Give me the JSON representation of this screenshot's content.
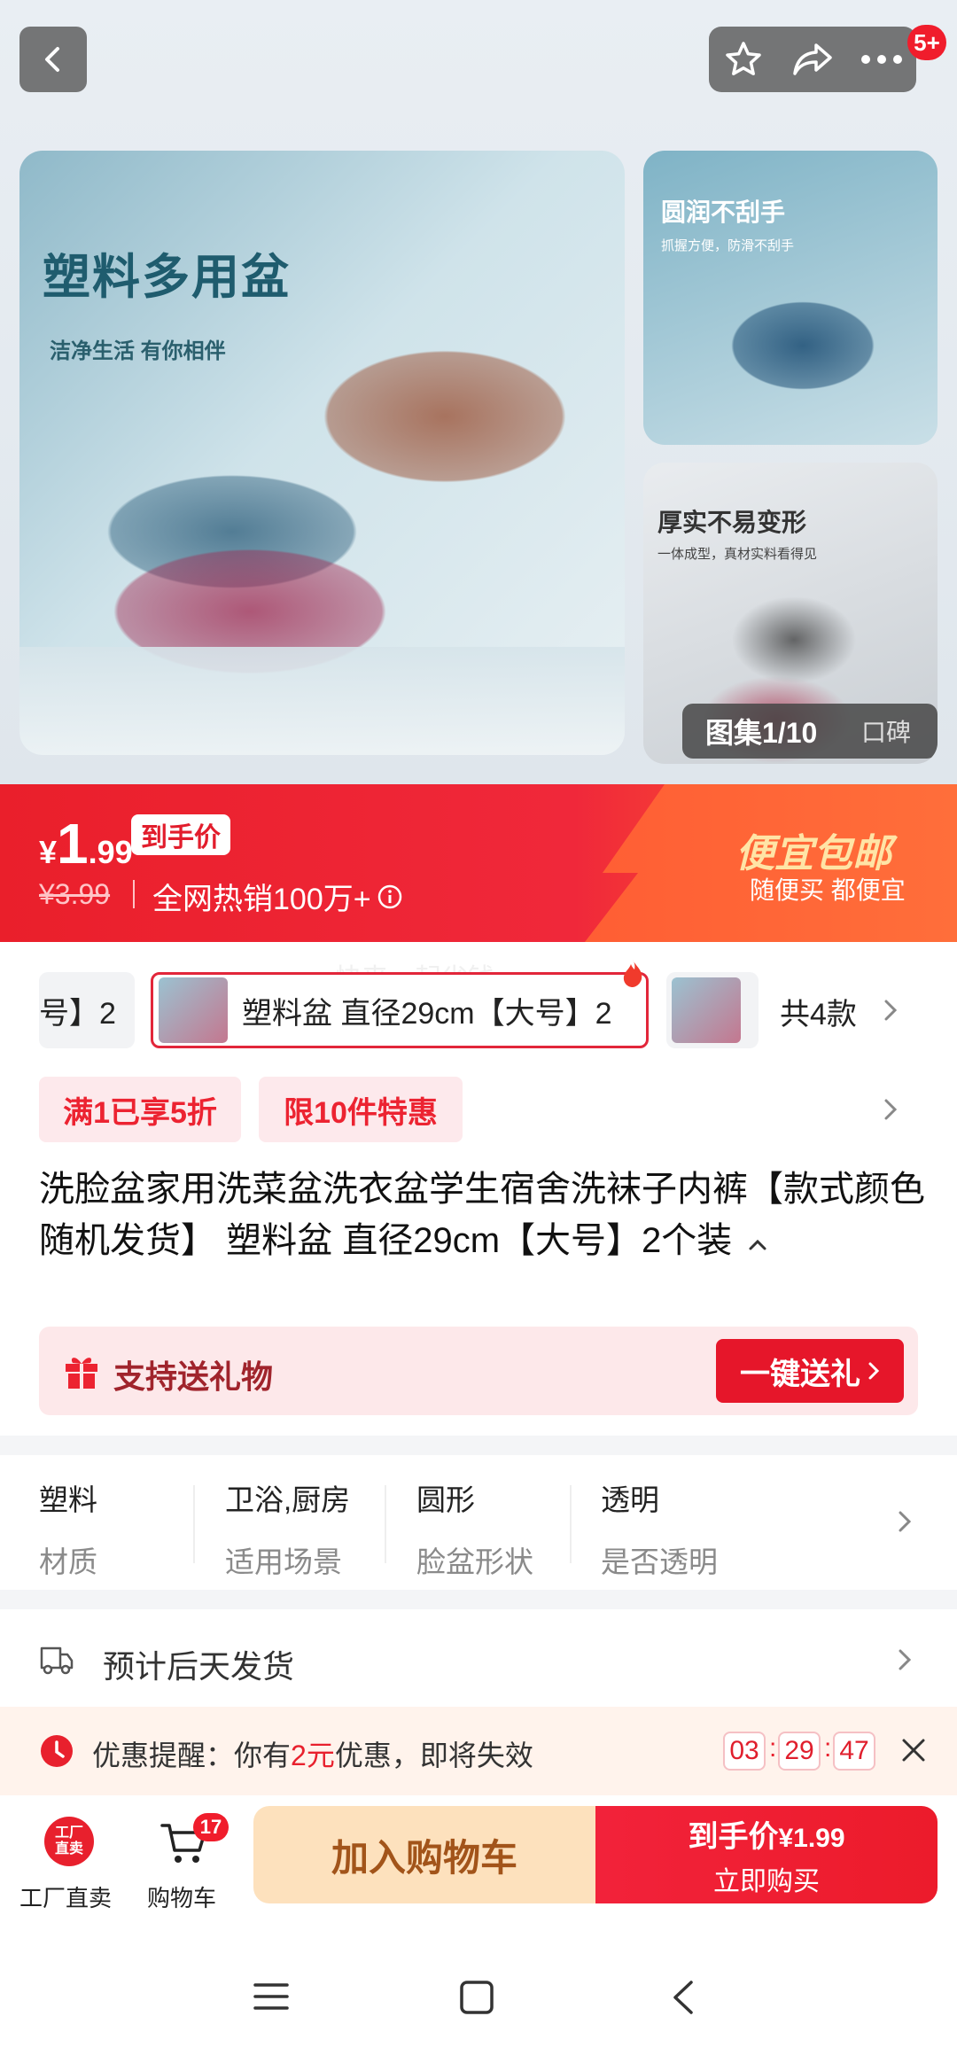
{
  "header": {
    "notify_badge": "5+"
  },
  "gallery": {
    "main_title": "塑料多用盆",
    "main_subtitle": "洁净生活 有你相伴",
    "side1_title": "圆润不刮手",
    "side1_subtitle": "抓握方便，防滑不刮手",
    "side2_title": "厚实不易变形",
    "side2_subtitle": "一体成型，真材实料看得见",
    "counter": "图集1/10",
    "review_tab": "口碑"
  },
  "price": {
    "currency": "¥",
    "integer": "1",
    "decimal": ".99",
    "tag": "到手价",
    "original": "¥3.99",
    "sales": "全网热销100万+",
    "promo_title": "便宜包邮",
    "promo_sub": "随便买 都便宜"
  },
  "sku": {
    "prev_chip": "号】2",
    "selected_chip": "塑料盆 直径29cm【大号】2",
    "watermark": "快来一起省钱",
    "total": "共4款"
  },
  "promos": [
    "满1已享5折",
    "限10件特惠"
  ],
  "product": {
    "title": "洗脸盆家用洗菜盆洗衣盆学生宿舍洗袜子内裤【款式颜色随机发货】 塑料盆 直径29cm【大号】2个装"
  },
  "gift": {
    "label": "支持送礼物",
    "button": "一键送礼"
  },
  "attributes": [
    {
      "value": "塑料",
      "key": "材质"
    },
    {
      "value": "卫浴,厨房",
      "key": "适用场景"
    },
    {
      "value": "圆形",
      "key": "脸盆形状"
    },
    {
      "value": "透明",
      "key": "是否透明"
    }
  ],
  "shipping": {
    "text": "预计后天发货"
  },
  "coupon_alert": {
    "prefix": "优惠提醒：你有",
    "amount": "2元",
    "suffix": "优惠，即将失效",
    "hh": "03",
    "mm": "29",
    "ss": "47"
  },
  "bottom_bar": {
    "factory_icon_text": "工厂直卖",
    "factory_label": "工厂直卖",
    "cart_label": "购物车",
    "cart_count": "17",
    "add_cart": "加入购物车",
    "buy_price_label": "到手价",
    "buy_price": "¥1.99",
    "buy_now": "立即购买"
  },
  "colors": {
    "brand_red": "#e8202d",
    "promo_gold": "#ffd9a0",
    "add_cart_bg": "#fde1bd",
    "add_cart_text": "#a2541a"
  }
}
